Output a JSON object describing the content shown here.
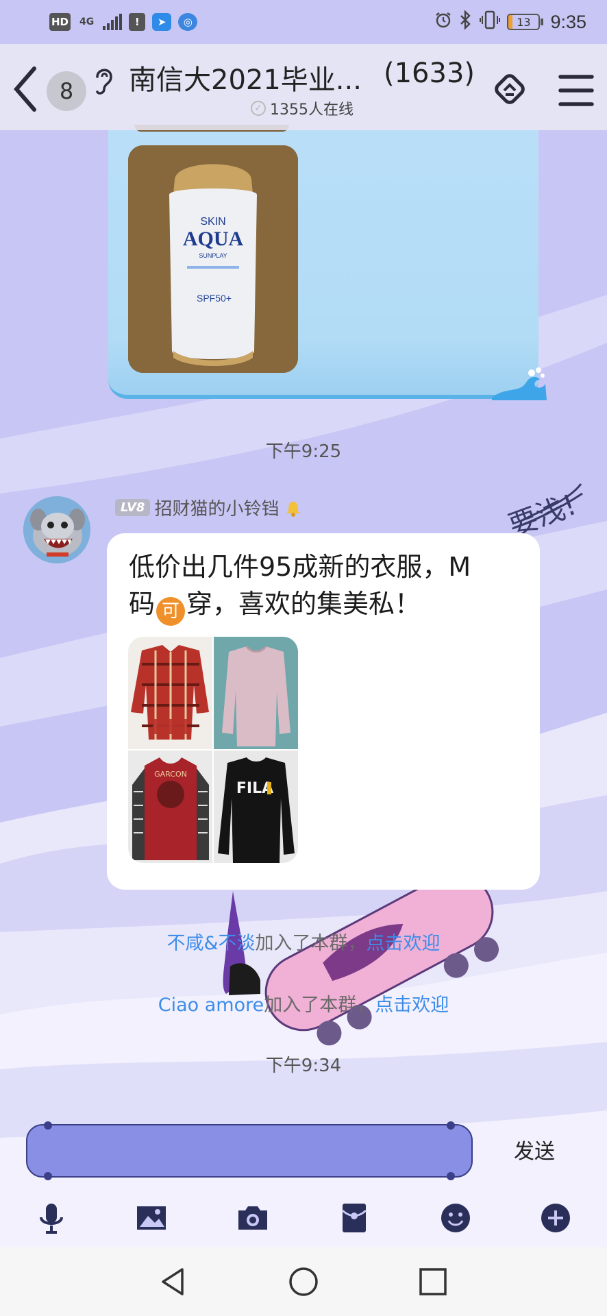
{
  "status_bar": {
    "hd": "HD",
    "network": "4G",
    "battery_level": "13",
    "time": "9:35"
  },
  "header": {
    "unread_count": "8",
    "group_name": "南信大2021毕业...",
    "member_count": "(1633)",
    "online": "1355人在线"
  },
  "messages": {
    "time_1": "下午9:25",
    "sender_level": "LV8",
    "sender_name": "招财猫的小铃铛",
    "text_line1": "低价出几件95成新的衣服，M",
    "text_line2_a": "码",
    "emoji": "可",
    "text_line2_b": "穿，喜欢的集美私！",
    "aqua_brand": "SKIN",
    "aqua_name": "AQUA",
    "aqua_sub": "SUNPLAY",
    "aqua_spf": "SPF50+",
    "fila": "FILA",
    "join_1_name": "不咸&不淡",
    "join_1_text": "加入了本群，",
    "join_1_link": "点击欢迎",
    "join_2_name": "Ciao amore",
    "join_2_text": "加入了本群，",
    "join_2_link": "点击欢迎",
    "time_2": "下午9:34"
  },
  "input": {
    "send": "发送"
  },
  "toolbar_icons": [
    "mic-icon",
    "image-icon",
    "camera-icon",
    "red-packet-icon",
    "emoji-icon",
    "plus-icon"
  ],
  "colors": {
    "background": "#c9c7f3",
    "input_fill": "#8a8fe6",
    "link": "#3d8ce8",
    "bubble_blue": "#b9def8"
  }
}
